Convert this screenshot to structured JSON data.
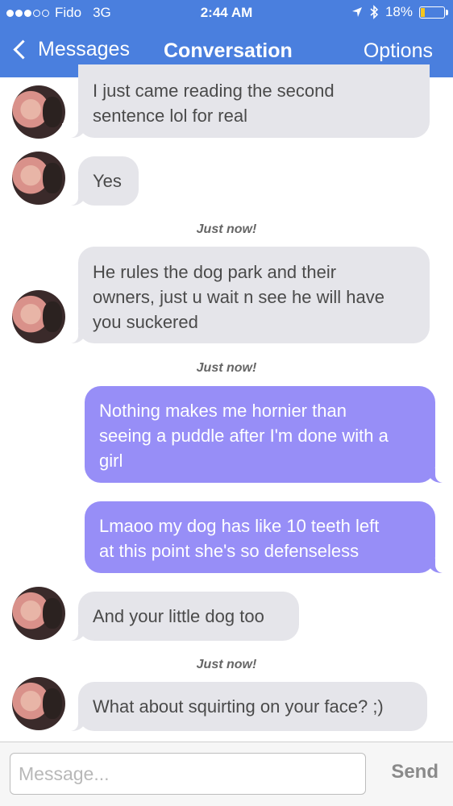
{
  "status_bar": {
    "carrier": "Fido",
    "network": "3G",
    "time": "2:44 AM",
    "battery": "18%",
    "battery_level": 0.18,
    "icons": [
      "signal-dots-icon",
      "location-arrow-icon",
      "bluetooth-icon",
      "battery-icon"
    ]
  },
  "nav": {
    "back_label": "Messages",
    "title": "Conversation",
    "options_label": "Options"
  },
  "messages": [
    {
      "direction": "incoming",
      "lines": [
        "I just came reading the second",
        "sentence lol for real"
      ]
    },
    {
      "direction": "incoming",
      "lines": [
        "Yes"
      ]
    },
    {
      "timestamp": "Just now!"
    },
    {
      "direction": "incoming",
      "lines": [
        "He rules the dog park and their",
        "owners, just u wait n see he will have",
        "you suckered"
      ]
    },
    {
      "timestamp": "Just now!"
    },
    {
      "direction": "outgoing",
      "lines": [
        "Nothing makes me hornier than",
        "seeing a puddle after I'm done with a",
        "girl"
      ]
    },
    {
      "direction": "outgoing",
      "lines": [
        "Lmaoo my dog has like 10 teeth left",
        "at this point she's so defenseless"
      ]
    },
    {
      "direction": "incoming",
      "lines": [
        "And your little dog too"
      ]
    },
    {
      "timestamp": "Just now!"
    },
    {
      "direction": "incoming",
      "lines": [
        "What about squirting on your face? ;)"
      ]
    }
  ],
  "composer": {
    "placeholder": "Message...",
    "value": "",
    "send_label": "Send"
  },
  "colors": {
    "header": "#4a7fde",
    "incoming_bubble": "#e5e5ea",
    "outgoing_bubble": "#978ef7",
    "battery_fill": "#f4c51e"
  }
}
